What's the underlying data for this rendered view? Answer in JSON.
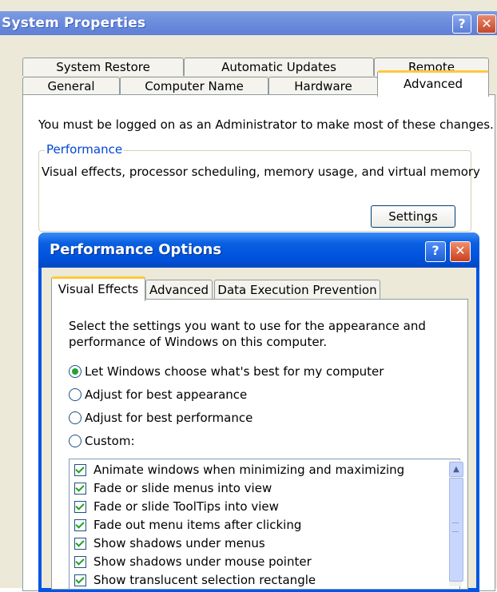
{
  "system_properties": {
    "title": "System Properties",
    "help_glyph": "?",
    "close_glyph": "✕",
    "tabs_row_back": [
      "System Restore",
      "Automatic Updates",
      "Remote"
    ],
    "tabs_row_front": [
      "General",
      "Computer Name",
      "Hardware",
      "Advanced"
    ],
    "active_tab": "Advanced",
    "admin_note": "You must be logged on as an Administrator to make most of these changes.",
    "performance": {
      "legend": "Performance",
      "description": "Visual effects, processor scheduling, memory usage, and virtual memory",
      "settings_label": "Settings"
    }
  },
  "performance_options": {
    "title": "Performance Options",
    "help_glyph": "?",
    "close_glyph": "✕",
    "tabs": [
      "Visual Effects",
      "Advanced",
      "Data Execution Prevention"
    ],
    "active_tab": "Visual Effects",
    "instructions": "Select the settings you want to use for the appearance and performance of Windows on this computer.",
    "radio_options": [
      {
        "label": "Let Windows choose what's best for my computer",
        "selected": true
      },
      {
        "label": "Adjust for best appearance",
        "selected": false
      },
      {
        "label": "Adjust for best performance",
        "selected": false
      },
      {
        "label": "Custom:",
        "selected": false
      }
    ],
    "effects": [
      {
        "label": "Animate windows when minimizing and maximizing",
        "checked": true
      },
      {
        "label": "Fade or slide menus into view",
        "checked": true
      },
      {
        "label": "Fade or slide ToolTips into view",
        "checked": true
      },
      {
        "label": "Fade out menu items after clicking",
        "checked": true
      },
      {
        "label": "Show shadows under menus",
        "checked": true
      },
      {
        "label": "Show shadows under mouse pointer",
        "checked": true
      },
      {
        "label": "Show translucent selection rectangle",
        "checked": true
      }
    ],
    "scroll_up_glyph": "▲"
  },
  "colors": {
    "xp_title_blue": "#0053DD",
    "tab_highlight": "#FFC83D",
    "group_legend": "#0046D5",
    "check_green": "#21A121"
  }
}
